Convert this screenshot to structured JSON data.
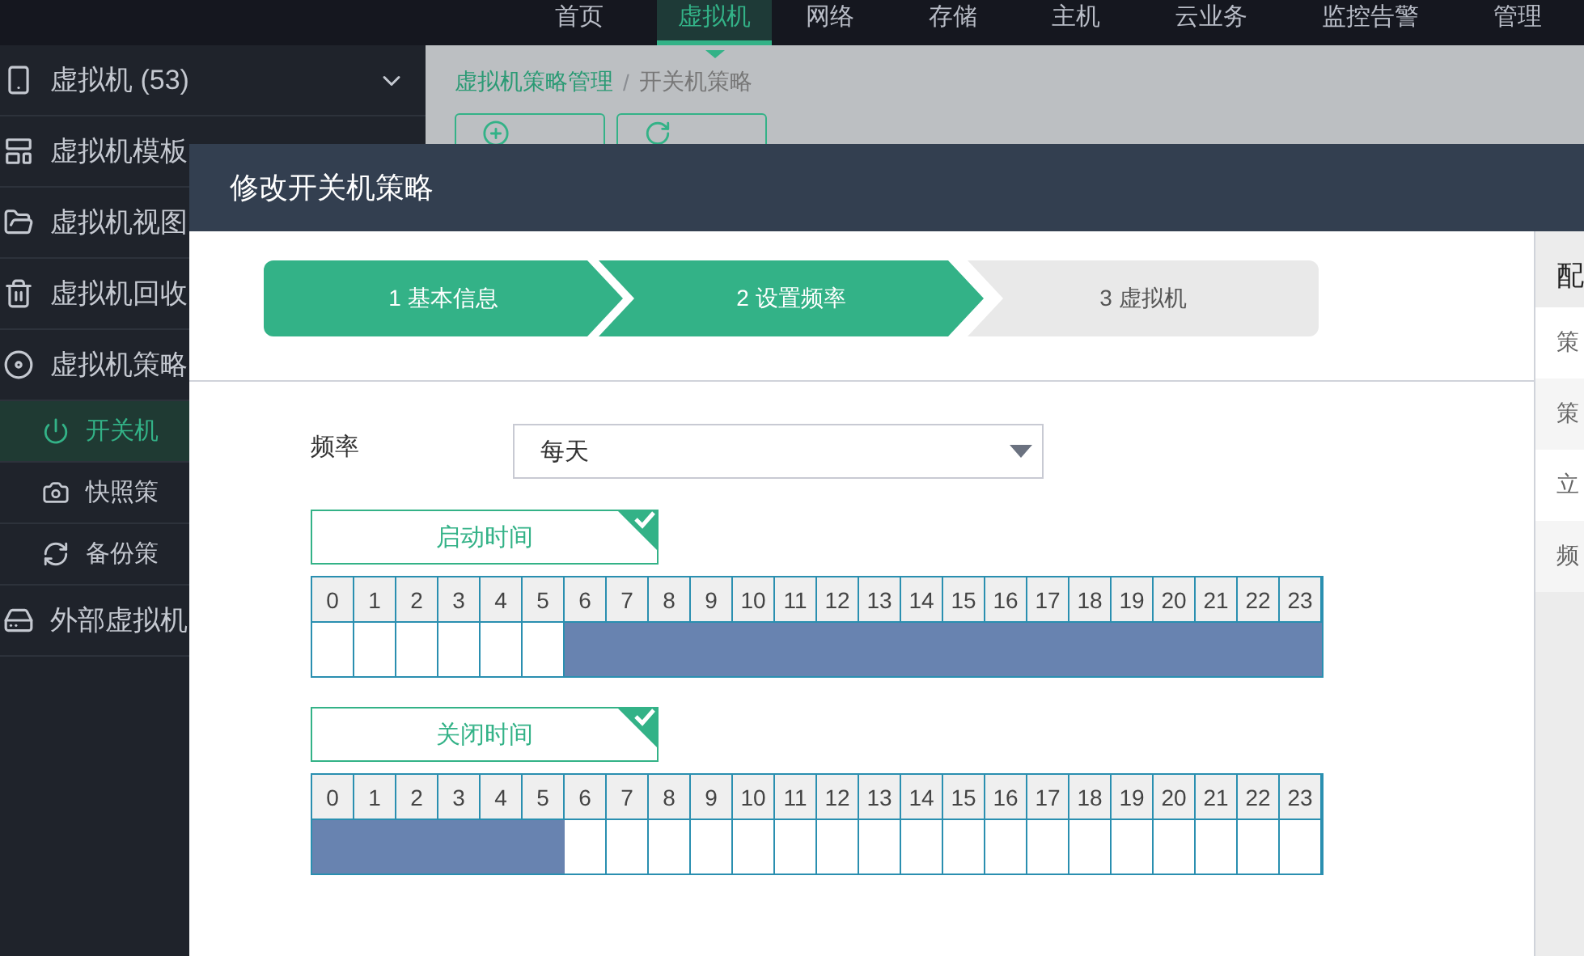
{
  "top_nav": [
    {
      "label": "首页",
      "selected": false
    },
    {
      "label": "虚拟机",
      "selected": true
    },
    {
      "label": "网络",
      "selected": false
    },
    {
      "label": "存储",
      "selected": false
    },
    {
      "label": "主机",
      "selected": false
    },
    {
      "label": "云业务",
      "selected": false
    },
    {
      "label": "监控告警",
      "selected": false
    },
    {
      "label": "管理",
      "selected": false
    }
  ],
  "sidebar": {
    "items": [
      {
        "label": "虚拟机 (53)",
        "expanded": true,
        "selected": false
      },
      {
        "label": "虚拟机模板",
        "selected": false
      },
      {
        "label": "虚拟机视图",
        "selected": false
      },
      {
        "label": "虚拟机回收",
        "selected": false
      },
      {
        "label": "虚拟机策略",
        "selected": false,
        "children": [
          {
            "label": "开关机",
            "selected": true
          },
          {
            "label": "快照策",
            "selected": false
          },
          {
            "label": "备份策",
            "selected": false
          }
        ]
      },
      {
        "label": "外部虚拟机",
        "selected": false
      }
    ]
  },
  "breadcrumb": [
    {
      "label": "虚拟机策略管理",
      "kind": "link"
    },
    {
      "label": "/",
      "kind": "separator"
    },
    {
      "label": "开关机策略",
      "kind": "current"
    }
  ],
  "toolbar": [
    {
      "kind": "add"
    },
    {
      "kind": "refresh"
    }
  ],
  "dialog": {
    "title": "修改开关机策略",
    "steps": [
      {
        "label": "1 基本信息",
        "active": true
      },
      {
        "label": "2 设置频率",
        "active": true
      },
      {
        "label": "3 虚拟机",
        "active": false
      }
    ],
    "frequency": {
      "label": "频率",
      "value": "每天"
    },
    "schedules": [
      {
        "title": "启动时间",
        "checked": true,
        "hours": [
          {
            "label": "0",
            "on": false
          },
          {
            "label": "1",
            "on": false
          },
          {
            "label": "2",
            "on": false
          },
          {
            "label": "3",
            "on": false
          },
          {
            "label": "4",
            "on": false
          },
          {
            "label": "5",
            "on": false
          },
          {
            "label": "6",
            "on": true
          },
          {
            "label": "7",
            "on": true
          },
          {
            "label": "8",
            "on": true
          },
          {
            "label": "9",
            "on": true
          },
          {
            "label": "10",
            "on": true
          },
          {
            "label": "11",
            "on": true
          },
          {
            "label": "12",
            "on": true
          },
          {
            "label": "13",
            "on": true
          },
          {
            "label": "14",
            "on": true
          },
          {
            "label": "15",
            "on": true
          },
          {
            "label": "16",
            "on": true
          },
          {
            "label": "17",
            "on": true
          },
          {
            "label": "18",
            "on": true
          },
          {
            "label": "19",
            "on": true
          },
          {
            "label": "20",
            "on": true
          },
          {
            "label": "21",
            "on": true
          },
          {
            "label": "22",
            "on": true
          },
          {
            "label": "23",
            "on": true
          }
        ]
      },
      {
        "title": "关闭时间",
        "checked": true,
        "hours": [
          {
            "label": "0",
            "on": true
          },
          {
            "label": "1",
            "on": true
          },
          {
            "label": "2",
            "on": true
          },
          {
            "label": "3",
            "on": true
          },
          {
            "label": "4",
            "on": true
          },
          {
            "label": "5",
            "on": true
          },
          {
            "label": "6",
            "on": false
          },
          {
            "label": "7",
            "on": false
          },
          {
            "label": "8",
            "on": false
          },
          {
            "label": "9",
            "on": false
          },
          {
            "label": "10",
            "on": false
          },
          {
            "label": "11",
            "on": false
          },
          {
            "label": "12",
            "on": false
          },
          {
            "label": "13",
            "on": false
          },
          {
            "label": "14",
            "on": false
          },
          {
            "label": "15",
            "on": false
          },
          {
            "label": "16",
            "on": false
          },
          {
            "label": "17",
            "on": false
          },
          {
            "label": "18",
            "on": false
          },
          {
            "label": "19",
            "on": false
          },
          {
            "label": "20",
            "on": false
          },
          {
            "label": "21",
            "on": false
          },
          {
            "label": "22",
            "on": false
          },
          {
            "label": "23",
            "on": false
          }
        ]
      }
    ],
    "side_panel": {
      "heading": "配",
      "rows": [
        "策",
        "策",
        "立",
        "频"
      ]
    }
  }
}
